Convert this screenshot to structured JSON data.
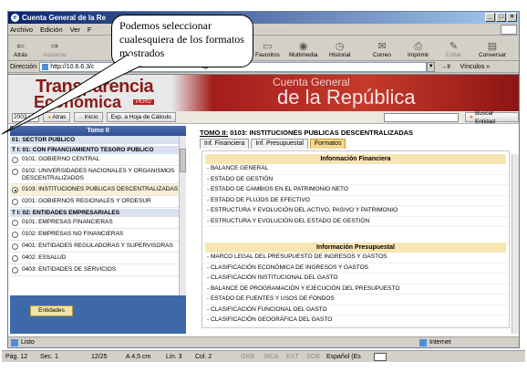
{
  "window": {
    "title": "Cuenta General de la Re",
    "controls": [
      "_",
      "□",
      "×"
    ]
  },
  "menu": [
    "Archivo",
    "Edición",
    "Ver",
    "F"
  ],
  "toolbar": [
    {
      "label": "Atrás",
      "icon": "back-arrow-icon"
    },
    {
      "label": "Adelante",
      "icon": "forward-arrow-icon"
    },
    {
      "label": "Favoritos",
      "icon": "favorites-icon"
    },
    {
      "label": "Multimedia",
      "icon": "multimedia-icon"
    },
    {
      "label": "Historial",
      "icon": "history-icon"
    },
    {
      "label": "Correo",
      "icon": "mail-icon"
    },
    {
      "label": "Imprimir",
      "icon": "print-icon"
    },
    {
      "label": "Editar",
      "icon": "edit-icon"
    },
    {
      "label": "Conversar",
      "icon": "chat-icon"
    }
  ],
  "address": {
    "label": "Dirección",
    "url": "http://10.6.6.3/c",
    "url_tail": "sp",
    "go": "Ir",
    "links": "Vínculos »"
  },
  "banner": {
    "line1": "Transparencia",
    "line2": "Económica",
    "badge": "PERU",
    "cg_top": "Cuenta General",
    "cg_bottom": "de la República"
  },
  "nav": {
    "year": "2003",
    "back": "Atras",
    "home": "Inicio",
    "export": "Exp. a Hoja de Cálculo",
    "search": "Buscar Entidad"
  },
  "left": {
    "tomo": "Tomo II",
    "sector": "01: SECTOR PUBLICO",
    "title1": "T I: 01: CON FINANCIAMIENTO TESORO PUBLICO",
    "items1": [
      {
        "text": "0101: GOBIERNO CENTRAL",
        "selected": false
      },
      {
        "text": "0102: UNIVERSIDADES NACIONALES Y ORGANISMOS DESCENTRALIZADOS",
        "selected": false
      },
      {
        "text": "0103: INSTITUCIONES PUBLICAS DESCENTRALIZADAS",
        "selected": true
      },
      {
        "text": "0201: GOBIERNOS REGIONALES Y ORDESUR",
        "selected": false
      }
    ],
    "title2": "T I: 02: ENTIDADES EMPRESARIALES",
    "items2": [
      {
        "text": "0101: EMPRESAS FINANCIERAS",
        "selected": false
      },
      {
        "text": "0102: EMPRESAS NO FINANCIERAS",
        "selected": false
      },
      {
        "text": "0401: ENTIDADES REGULADORAS Y SUPERVISORAS",
        "selected": false
      },
      {
        "text": "0402: ESSALUD",
        "selected": false
      },
      {
        "text": "0403: ENTIDADES DE SERVICIOS",
        "selected": false
      }
    ],
    "entidades": "Entidades"
  },
  "right": {
    "title_prefix": "TOMO II:",
    "title_rest": " 0103: INSTITUCIONES PUBLICAS DESCENTRALIZADAS",
    "tabs": [
      "Inf. Financiera",
      "Inf. Presupuestal",
      "Formatos"
    ],
    "sec1": "Información Financiera",
    "fin": [
      "- BALANCE GENERAL",
      "- ESTADO DE GESTIÓN",
      "- ESTADO DE CAMBIOS EN EL PATRIMONIO NETO",
      "- ESTADO DE FLUJOS DE EFECTIVO",
      "- ESTRUCTURA Y EVOLUCIÓN DEL ACTIVO, PASIVO Y PATRIMONIO",
      "- ESTRUCTURA Y EVOLUCIÓN DEL ESTADO DE GESTIÓN"
    ],
    "sec2": "Información Presupuestal",
    "pres": [
      "- MARCO LEGAL DEL PRESUPUESTO DE INGRESOS Y GASTOS",
      "- CLASIFICACIÓN ECONÓMICA DE INGRESOS Y GASTOS",
      "- CLASIFICACIÓN INSTITUCIONAL DEL GASTO",
      "- BALANCE DE PROGRAMACIÓN Y EJECUCIÓN DEL PRESUPUESTO",
      "- ESTADO DE FUENTES Y USOS DE FONDOS",
      "- CLASIFICACIÓN FUNCIONAL DEL GASTO",
      "- CLASIFICACIÓN GEOGRÁFICA DEL GASTO"
    ]
  },
  "status": {
    "left": "Listo",
    "zone": "Internet"
  },
  "word": {
    "page": "Pág. 12",
    "sec": "Sec. 1",
    "pages": "12/25",
    "at": "A 4,5 cm",
    "line": "Lín. 3",
    "col": "Col. 2",
    "grb": "GRB",
    "mca": "MCA",
    "ext": "EXT",
    "sob": "SOB",
    "lang": "Español (Es"
  },
  "callout": "Podemos seleccionar cualesquiera de los formatos mostrados"
}
